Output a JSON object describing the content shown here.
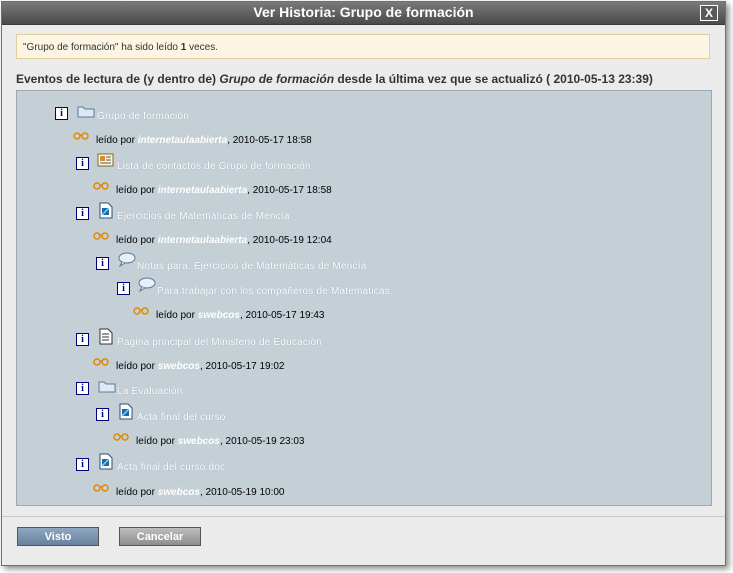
{
  "dialog": {
    "title": "Ver Historia: Grupo de formación",
    "close_label": "X"
  },
  "notice": {
    "prefix": "\"Grupo de formación\" ha sido leído ",
    "count": "1",
    "suffix": " veces."
  },
  "events_header": {
    "prefix": "Eventos de lectura de (y dentro de) ",
    "name": "Grupo de formación",
    "suffix": " desde la última vez que se actualizó ( 2010-05-13 23:39)"
  },
  "tree": {
    "items": [
      {
        "label": "Grupo de formación",
        "read_prefix": "leído por ",
        "user": "internetaulaabierta",
        "timestamp": ", 2010-05-17 18:58"
      },
      {
        "label": "Lista de contactos de Grupo de formación",
        "read_prefix": "leído por ",
        "user": "internetaulaabierta",
        "timestamp": ", 2010-05-17 18:58"
      },
      {
        "label": "Ejercicios de Matemáticas de Mencía",
        "read_prefix": "leído por ",
        "user": "internetaulaabierta",
        "timestamp": ", 2010-05-19 12:04"
      },
      {
        "label": "Notas para: Ejercicios de Matemáticas de Mencía"
      },
      {
        "label": "Para trabajar con los compañeros de Matemáticas.",
        "read_prefix": "leído por ",
        "user": "swebcos",
        "timestamp": ", 2010-05-17 19:43"
      },
      {
        "label": "Pagina principal del Ministerio de Educación",
        "read_prefix": "leído por ",
        "user": "swebcos",
        "timestamp": ", 2010-05-17 19:02"
      },
      {
        "label": "La Evaluación"
      },
      {
        "label": "Acta final del curso",
        "read_prefix": "leído por ",
        "user": "swebcos",
        "timestamp": ", 2010-05-19 23:03"
      },
      {
        "label": "Acta final del curso.doc",
        "read_prefix": "leído por ",
        "user": "swebcos",
        "timestamp": ", 2010-05-19 10:00"
      }
    ],
    "info_label": "i"
  },
  "buttons": {
    "visto": "Visto",
    "cancelar": "Cancelar"
  }
}
